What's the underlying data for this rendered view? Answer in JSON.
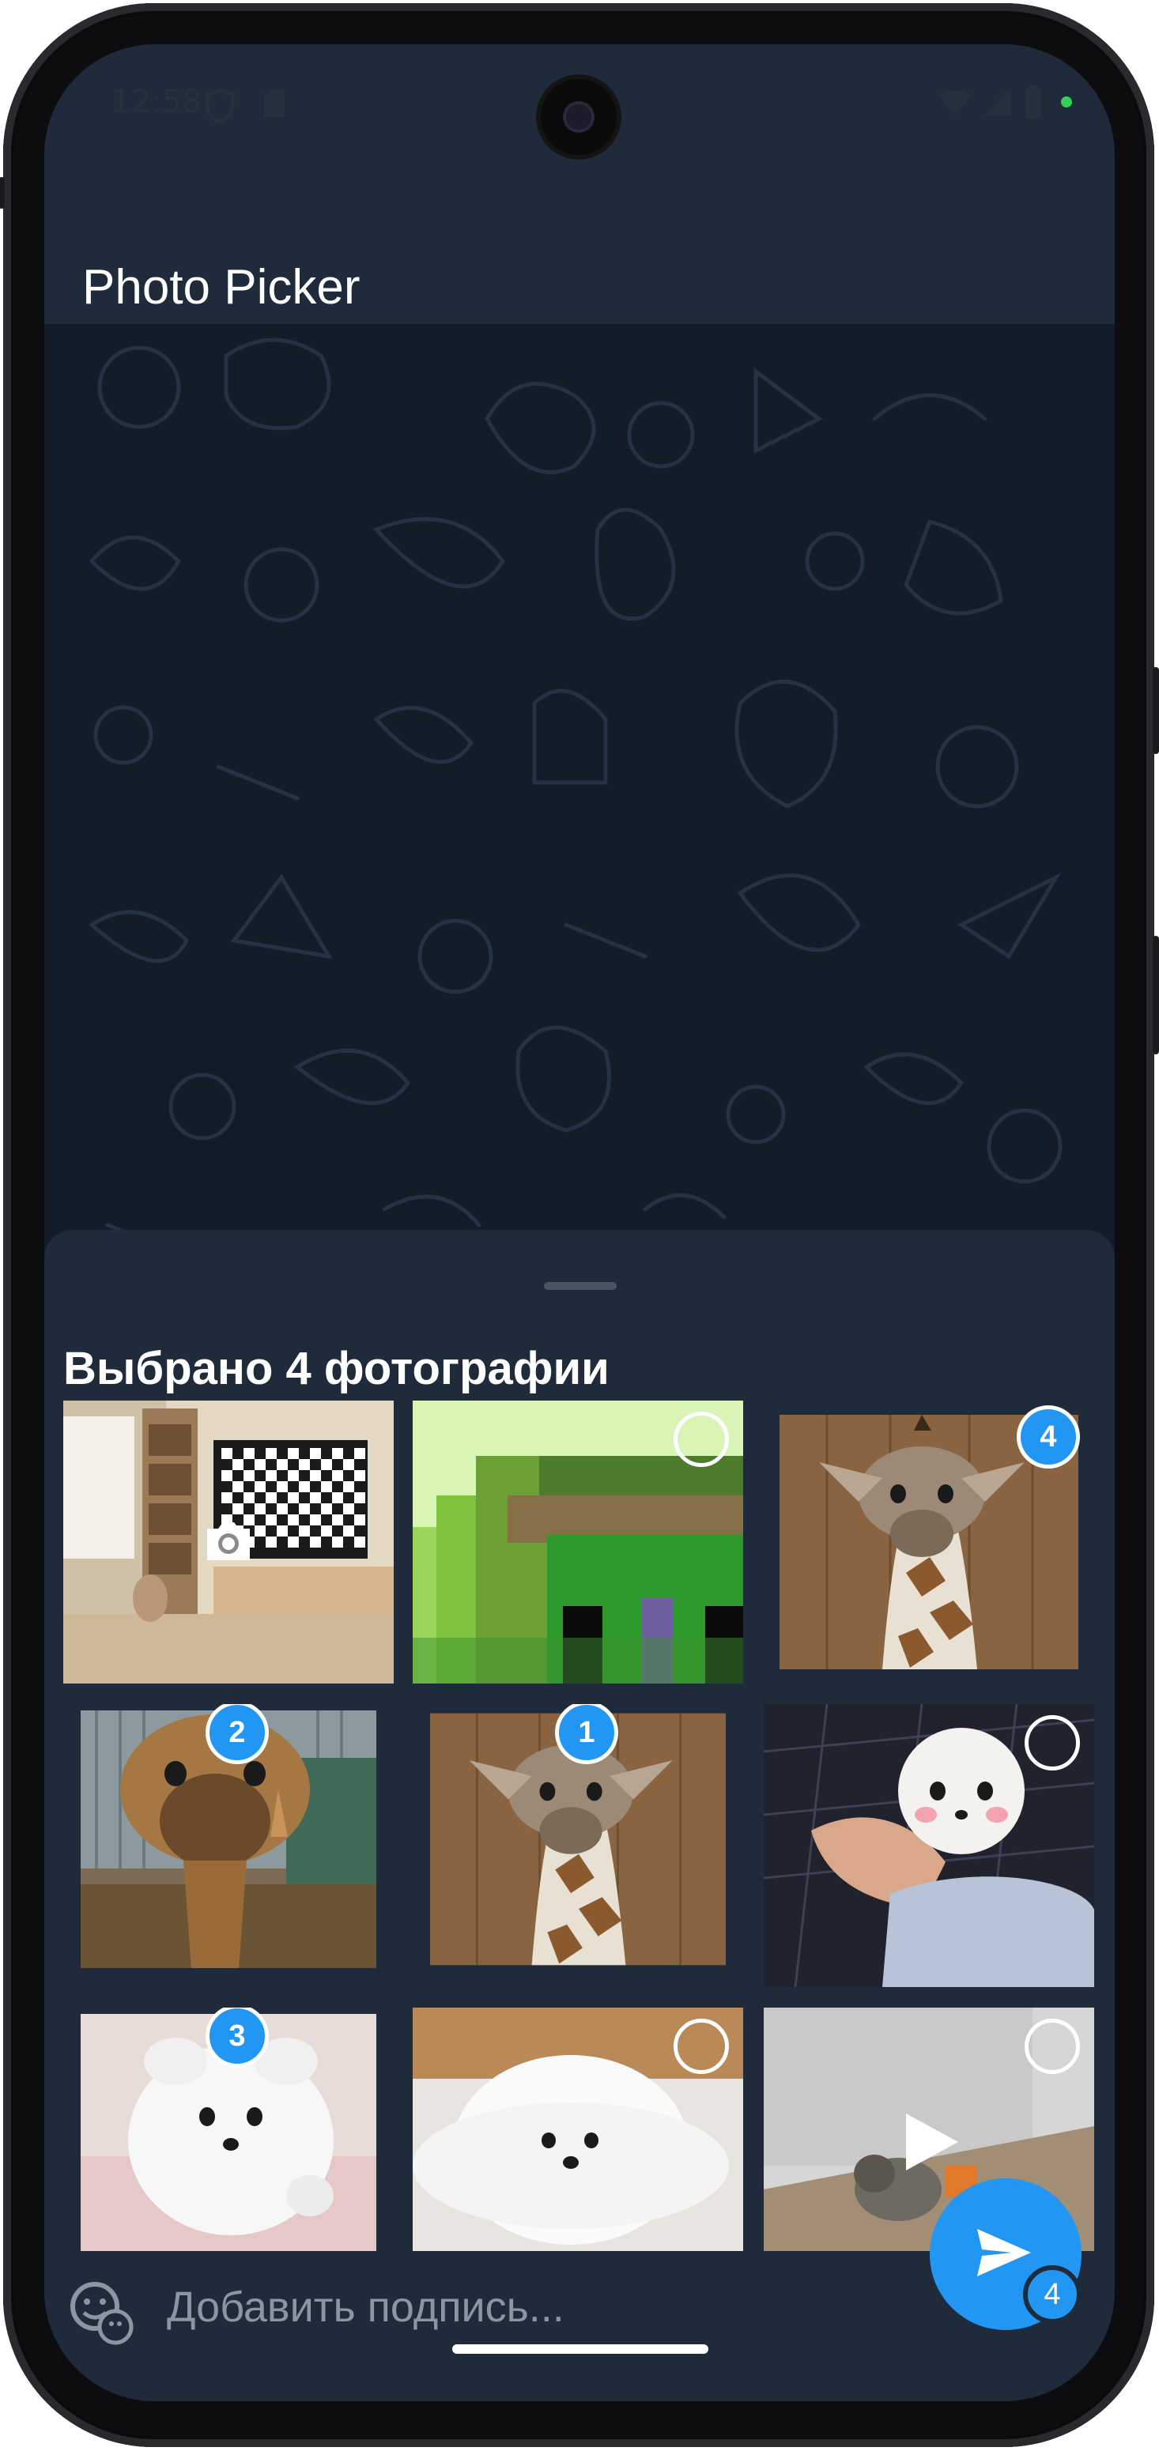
{
  "status_bar": {
    "time": "12:58"
  },
  "app_bar": {
    "title": "Photo Picker"
  },
  "sheet": {
    "title": "Выбрано 4 фотографии"
  },
  "grid": {
    "tiles": [
      {
        "name": "camera-tile",
        "kind": "camera"
      },
      {
        "name": "pixel-image-tile",
        "kind": "unselected"
      },
      {
        "name": "giraffe-tile-a",
        "kind": "selected",
        "badge": "4"
      },
      {
        "name": "giraffe-tile-b",
        "kind": "selected",
        "badge": "2"
      },
      {
        "name": "giraffe-tile-c",
        "kind": "selected",
        "badge": "1"
      },
      {
        "name": "puppy-tile-a",
        "kind": "unselected"
      },
      {
        "name": "puppy-tile-b",
        "kind": "selected",
        "badge": "3"
      },
      {
        "name": "puppy-tile-c",
        "kind": "unselected"
      },
      {
        "name": "video-tile",
        "kind": "unselected"
      }
    ]
  },
  "caption": {
    "placeholder": "Добавить подпись..."
  },
  "send": {
    "count": "4"
  },
  "icons": {
    "camera": "camera-icon",
    "emoji": "emoji-icon",
    "send": "send-icon",
    "play": "play-icon",
    "wifi": "wifi-icon",
    "signal": "signal-icon",
    "battery": "battery-icon",
    "shield": "shield-icon",
    "sim": "sim-card-icon"
  },
  "colors": {
    "accent": "#2196f3",
    "sheet_bg": "#1f2b3a",
    "chat_bg": "#121d29"
  }
}
